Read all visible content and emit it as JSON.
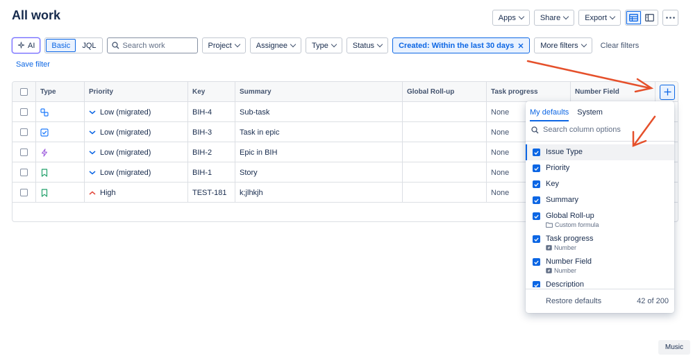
{
  "page": {
    "title": "All work"
  },
  "top_actions": {
    "apps": "Apps",
    "share": "Share",
    "export": "Export"
  },
  "filters": {
    "ai_label": "AI",
    "basic_label": "Basic",
    "jql_label": "JQL",
    "search_placeholder": "Search work",
    "project": "Project",
    "assignee": "Assignee",
    "type": "Type",
    "status": "Status",
    "created_prefix": "Created:",
    "created_value": "Within the last 30 days",
    "more_filters": "More filters",
    "clear_filters": "Clear filters"
  },
  "save_filter": "Save filter",
  "table": {
    "headers": {
      "type": "Type",
      "priority": "Priority",
      "key": "Key",
      "summary": "Summary",
      "global_rollup": "Global Roll-up",
      "task_progress": "Task progress",
      "number_field": "Number Field"
    },
    "rows": [
      {
        "type_icon": "subtask-icon",
        "priority_icon": "priority-low-icon",
        "priority": "Low (migrated)",
        "key": "BIH-4",
        "summary": "Sub-task",
        "global_rollup": "",
        "task_progress": "None"
      },
      {
        "type_icon": "task-icon",
        "priority_icon": "priority-low-icon",
        "priority": "Low (migrated)",
        "key": "BIH-3",
        "summary": "Task in epic",
        "global_rollup": "",
        "task_progress": "None"
      },
      {
        "type_icon": "epic-icon",
        "priority_icon": "priority-low-icon",
        "priority": "Low (migrated)",
        "key": "BIH-2",
        "summary": "Epic in BIH",
        "global_rollup": "",
        "task_progress": "None"
      },
      {
        "type_icon": "story-icon",
        "priority_icon": "priority-low-icon",
        "priority": "Low (migrated)",
        "key": "BIH-1",
        "summary": "Story",
        "global_rollup": "",
        "task_progress": "None"
      },
      {
        "type_icon": "story-icon",
        "priority_icon": "priority-high-icon",
        "priority": "High",
        "key": "TEST-181",
        "summary": "k;jlhkjh",
        "global_rollup": "",
        "task_progress": "None"
      }
    ]
  },
  "column_picker": {
    "tab_defaults": "My defaults",
    "tab_system": "System",
    "search_placeholder": "Search column options",
    "items": [
      {
        "label": "Issue Type",
        "checked": true,
        "sub": ""
      },
      {
        "label": "Priority",
        "checked": true,
        "sub": ""
      },
      {
        "label": "Key",
        "checked": true,
        "sub": ""
      },
      {
        "label": "Summary",
        "checked": true,
        "sub": ""
      },
      {
        "label": "Global Roll-up",
        "checked": true,
        "sub": "Custom formula"
      },
      {
        "label": "Task progress",
        "checked": true,
        "sub": "Number"
      },
      {
        "label": "Number Field",
        "checked": true,
        "sub": "Number"
      },
      {
        "label": "Description",
        "checked": true,
        "sub": ""
      }
    ],
    "restore_defaults": "Restore defaults",
    "count": "42 of 200"
  },
  "music_chip": "Music",
  "colors": {
    "accent": "#0c66e4",
    "annotation_arrow": "#e5502b",
    "ai_border": "#7b61ff"
  }
}
